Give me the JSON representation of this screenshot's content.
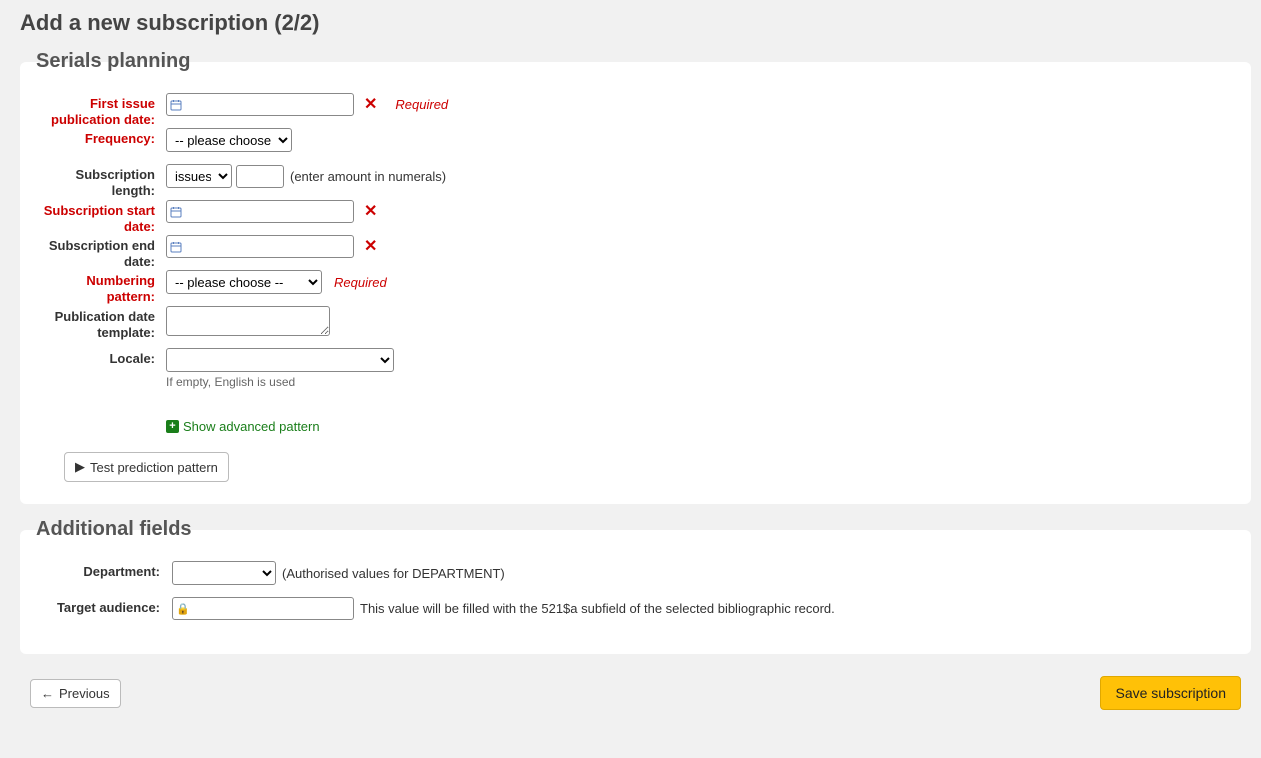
{
  "page": {
    "title": "Add a new subscription (2/2)"
  },
  "planning": {
    "legend": "Serials planning",
    "first_issue_label": "First issue publication date:",
    "required_label": "Required",
    "frequency_label": "Frequency:",
    "frequency_placeholder": "-- please choose --",
    "sub_length_label": "Subscription length:",
    "sub_length_unit": "issues",
    "sub_length_note": "(enter amount in numerals)",
    "start_date_label": "Subscription start date:",
    "end_date_label": "Subscription end date:",
    "numbering_label": "Numbering pattern:",
    "numbering_placeholder": "-- please choose --",
    "pubdate_tpl_label": "Publication date template:",
    "locale_label": "Locale:",
    "locale_hint": "If empty, English is used",
    "adv_link": "Show advanced pattern",
    "test_btn": "Test prediction pattern"
  },
  "additional": {
    "legend": "Additional fields",
    "dept_label": "Department:",
    "dept_note": "(Authorised values for DEPARTMENT)",
    "target_label": "Target audience:",
    "target_note": "This value will be filled with the 521$a subfield of the selected bibliographic record."
  },
  "footer": {
    "prev": "Previous",
    "save": "Save subscription"
  }
}
